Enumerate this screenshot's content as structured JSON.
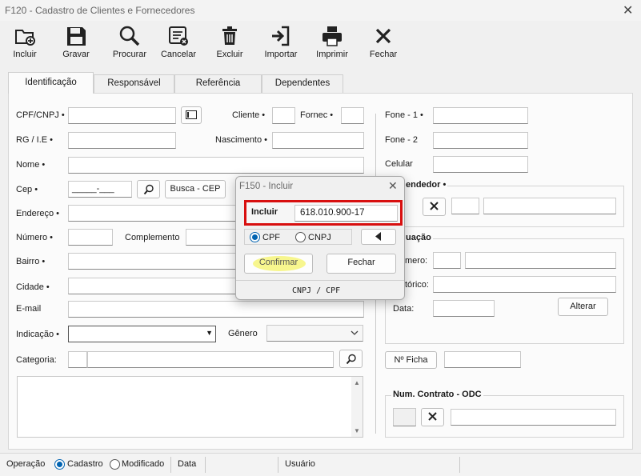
{
  "window": {
    "title": "F120 - Cadastro de Clientes e Fornecedores",
    "close_glyph": "✕"
  },
  "toolbar": [
    {
      "id": "incluir",
      "label": "Incluir",
      "icon": "folder-plus-icon"
    },
    {
      "id": "gravar",
      "label": "Gravar",
      "icon": "save-icon"
    },
    {
      "id": "procurar",
      "label": "Procurar",
      "icon": "magnifier-icon"
    },
    {
      "id": "cancelar",
      "label": "Cancelar",
      "icon": "cancel-list-icon"
    },
    {
      "id": "excluir",
      "label": "Excluir",
      "icon": "trash-icon"
    },
    {
      "id": "importar",
      "label": "Importar",
      "icon": "import-icon"
    },
    {
      "id": "imprimir",
      "label": "Imprimir",
      "icon": "printer-icon"
    },
    {
      "id": "fechar",
      "label": "Fechar",
      "icon": "close-x-icon"
    }
  ],
  "tabs": [
    "Identificação",
    "Responsável",
    "Referência",
    "Dependentes"
  ],
  "form": {
    "cpf_cnpj": "CPF/CNPJ •",
    "cliente": "Cliente •",
    "fornec": "Fornec •",
    "rg_ie": "RG / I.E •",
    "nascimento": "Nascimento •",
    "nome": "Nome •",
    "cep": "Cep •",
    "cep_mask": "_____-___",
    "busca_cep": "Busca - CEP",
    "endereco": "Endereço •",
    "numero": "Número •",
    "complemento": "Complemento",
    "bairro": "Bairro •",
    "cidade": "Cidade •",
    "email": "E-mail",
    "indicacao": "Indicação •",
    "genero": "Gênero",
    "categoria": "Categoria:"
  },
  "right": {
    "fone1": "Fone - 1 •",
    "fone2": "Fone - 2",
    "celular": "Celular",
    "vendedor": "endedor •",
    "situacao": "uação",
    "numero": "mero:",
    "historico": "tórico:",
    "data": "Data:",
    "alterar": "Alterar",
    "nficha": "Nº Ficha",
    "contrato": "Num. Contrato - ODC"
  },
  "dialog": {
    "title": "F150 - Incluir",
    "close_glyph": "✕",
    "incluir_label": "Incluir",
    "incluir_value": "618.010.900-17",
    "opt_cpf": "CPF",
    "opt_cnpj": "CNPJ",
    "selected": "CPF",
    "confirmar": "Confirmar",
    "fechar": "Fechar",
    "footer": "CNPJ / CPF"
  },
  "status": {
    "operacao": "Operação",
    "cadastro": "Cadastro",
    "modificado": "Modificado",
    "selected": "Cadastro",
    "data": "Data",
    "usuario": "Usuário"
  },
  "colors": {
    "accent": "#0063b1",
    "highlight_box": "#d80f0f",
    "marker": "#f6f47a"
  }
}
